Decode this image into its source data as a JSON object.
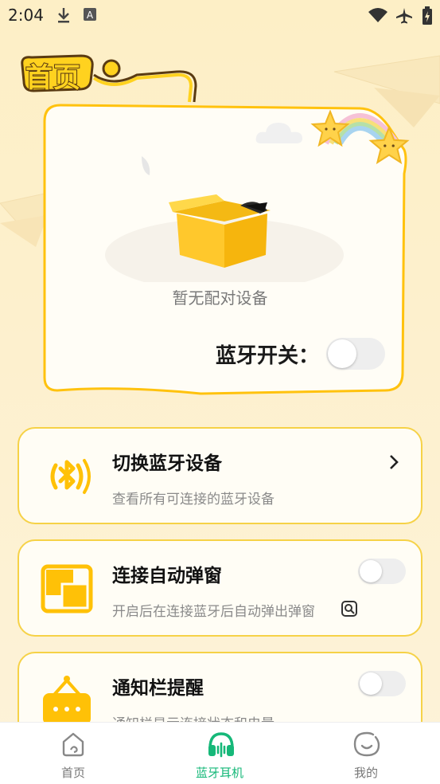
{
  "status_bar": {
    "time": "2:04",
    "left_icons": [
      "download-icon",
      "a-box-icon"
    ],
    "right_icons": [
      "wifi-icon",
      "airplane-icon",
      "battery-icon"
    ]
  },
  "page": {
    "title": "首页"
  },
  "bluetooth_card": {
    "empty_text": "暂无配对设备",
    "switch_label": "蓝牙开关：",
    "switch_on": false
  },
  "features": [
    {
      "title": "切换蓝牙设备",
      "subtitle": "查看所有可连接的蓝牙设备",
      "icon": "bluetooth-icon",
      "action": "chevron-right-icon"
    },
    {
      "title": "连接自动弹窗",
      "subtitle": "开启后在连接蓝牙后自动弹出弹窗",
      "icon": "popup-window-icon",
      "toggle_on": false,
      "extra_icon": "search-preview-icon"
    },
    {
      "title": "通知栏提醒",
      "subtitle": "通知栏显示连接状态和电量",
      "icon": "notification-panel-icon",
      "toggle_on": false
    }
  ],
  "bottom_nav": {
    "active_color": "#16b879",
    "items": [
      {
        "label": "首页",
        "icon": "home-icon",
        "active": false
      },
      {
        "label": "蓝牙耳机",
        "icon": "headphones-icon",
        "active": true
      },
      {
        "label": "我的",
        "icon": "smile-icon",
        "active": false
      }
    ]
  },
  "colors": {
    "accent_yellow": "#ffc107",
    "card_border": "#f6d247",
    "background": "#fdefc6"
  }
}
